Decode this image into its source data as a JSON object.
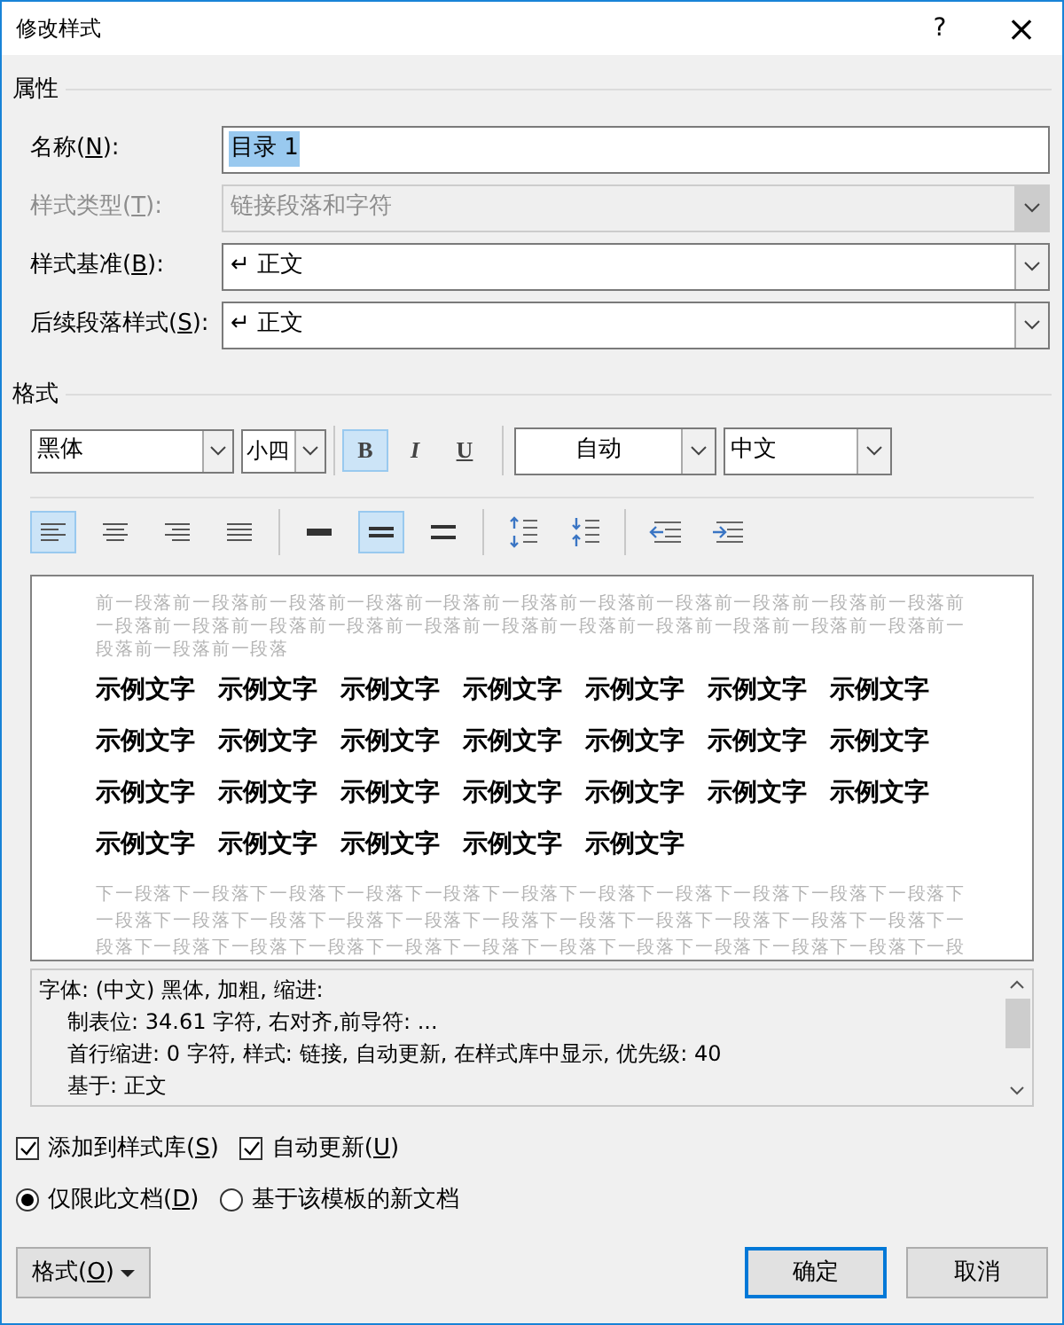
{
  "window": {
    "title": "修改样式",
    "help": "?",
    "close": "×"
  },
  "properties": {
    "heading": "属性",
    "rows": [
      {
        "kind": "text",
        "label": "名称(",
        "key": "N",
        "after": "):",
        "value": "目录 1",
        "disabled": false
      },
      {
        "kind": "combo",
        "label": "样式类型(",
        "key": "T",
        "after": "):",
        "value": "链接段落和字符",
        "disabled": true
      },
      {
        "kind": "combo",
        "label": "样式基准(",
        "key": "B",
        "after": "):",
        "value": "↵ 正文",
        "disabled": false
      },
      {
        "kind": "combo",
        "label": "后续段落样式(",
        "key": "S",
        "after": "):",
        "value": "↵ 正文",
        "disabled": false
      }
    ]
  },
  "format": {
    "heading": "格式",
    "font": "黑体",
    "size": "小四",
    "styles": [
      {
        "label": "B",
        "selected": true
      },
      {
        "label": "I",
        "selected": false
      },
      {
        "label": "U",
        "selected": false
      }
    ],
    "font_color": "自动",
    "script": "中文",
    "align": [
      {
        "selected": true
      },
      {
        "selected": false
      },
      {
        "selected": false
      },
      {
        "selected": false
      }
    ],
    "spacing": [
      {
        "selected": false
      },
      {
        "selected": true
      },
      {
        "selected": false
      }
    ]
  },
  "preview": {
    "before": [
      "前一段落前一段落前一段落前一段落前一段落前一段落前一段落前一段落前一段落前一段落前一段落前",
      "一段落前一段落前一段落前一段落前一段落前一段落前一段落前一段落前一段落前一段落前一段落前一",
      "段落前一段落前一段落"
    ],
    "sample": [
      [
        "示例文字",
        "示例文字",
        "示例文字",
        "示例文字",
        "示例文字",
        "示例文字",
        "示例文字"
      ],
      [
        "示例文字",
        "示例文字",
        "示例文字",
        "示例文字",
        "示例文字",
        "示例文字",
        "示例文字"
      ],
      [
        "示例文字",
        "示例文字",
        "示例文字",
        "示例文字",
        "示例文字",
        "示例文字",
        "示例文字"
      ],
      [
        "示例文字",
        "示例文字",
        "示例文字",
        "示例文字",
        "示例文字"
      ]
    ],
    "after": [
      "下一段落下一段落下一段落下一段落下一段落下一段落下一段落下一段落下一段落下一段落下一段落下",
      "一段落下一段落下一段落下一段落下一段落下一段落下一段落下一段落下一段落下一段落下一段落下一",
      "段落下一段落下一段落下一段落下一段落下一段落下一段落下一段落下一段落下一段落下一段落下一段"
    ]
  },
  "description": [
    "字体: (中文) 黑体, 加粗, 缩进:",
    "制表位:  34.61 字符, 右对齐,前导符: ...",
    "首行缩进:  0 字符, 样式: 链接, 自动更新, 在样式库中显示, 优先级: 40",
    "基于: 正文"
  ],
  "checkboxes": [
    {
      "label": "添加到样式库(",
      "key": "S",
      "after": ")",
      "checked": true
    },
    {
      "label": "自动更新(",
      "key": "U",
      "after": ")",
      "checked": true
    }
  ],
  "radios": [
    {
      "label": "仅限此文档(",
      "key": "D",
      "after": ")",
      "selected": true
    },
    {
      "label": "基于该模板的新文档",
      "selected": false
    }
  ],
  "buttons": {
    "format": {
      "label": "格式(",
      "key": "O",
      "after": ")"
    },
    "ok": "确定",
    "cancel": "取消"
  }
}
